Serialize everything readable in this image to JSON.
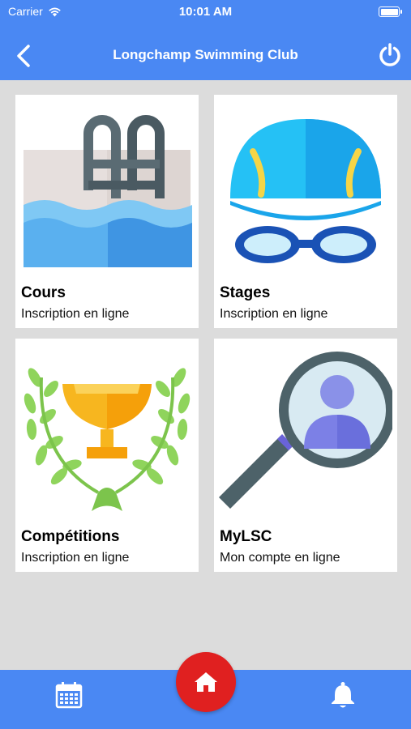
{
  "status_bar": {
    "carrier": "Carrier",
    "time": "10:01 AM",
    "wifi_icon": "wifi-icon",
    "battery_icon": "battery-icon"
  },
  "nav": {
    "title": "Longchamp Swimming Club",
    "back_icon": "chevron-left-icon",
    "power_icon": "power-icon"
  },
  "cards": [
    {
      "title": "Cours",
      "subtitle": "Inscription en ligne",
      "icon": "swimming-pool-icon"
    },
    {
      "title": "Stages",
      "subtitle": "Inscription en ligne",
      "icon": "swim-cap-goggles-icon"
    },
    {
      "title": "Compétitions",
      "subtitle": "Inscription en ligne",
      "icon": "trophy-icon"
    },
    {
      "title": "MyLSC",
      "subtitle": "Mon compte en ligne",
      "icon": "user-search-icon"
    }
  ],
  "tabbar": {
    "left_icon": "calendar-icon",
    "center_icon": "home-icon",
    "right_icon": "bell-icon"
  },
  "colors": {
    "header_bg": "#4a88f3",
    "page_bg": "#dcdcdc",
    "home_button": "#e02020"
  }
}
